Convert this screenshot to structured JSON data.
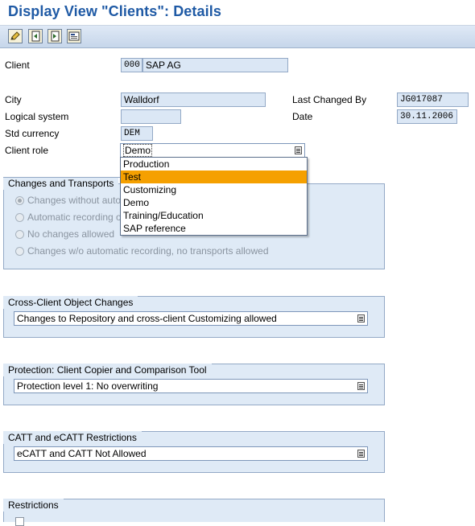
{
  "window": {
    "title": "Display View \"Clients\": Details"
  },
  "toolbar": {
    "buttons": [
      "edit-icon",
      "previous-entry-icon",
      "next-entry-icon",
      "transport-icon"
    ]
  },
  "form": {
    "client_label": "Client",
    "client_number": "000",
    "client_name": "SAP AG",
    "city_label": "City",
    "city_value": "Walldorf",
    "logical_system_label": "Logical system",
    "logical_system_value": "",
    "std_currency_label": "Std currency",
    "std_currency_value": "DEM",
    "client_role_label": "Client role",
    "client_role_value": "Demo",
    "last_changed_by_label": "Last Changed By",
    "last_changed_by_value": "JG017087",
    "date_label": "Date",
    "date_value": "30.11.2006"
  },
  "client_role_dropdown": {
    "options": [
      "Production",
      "Test",
      "Customizing",
      "Demo",
      "Training/Education",
      "SAP reference"
    ],
    "highlighted": "Test"
  },
  "changes_transports": {
    "title": "Changes and Transports",
    "options": [
      "Changes without automatic recording",
      "Automatic recording of changes",
      "No changes allowed",
      "Changes w/o automatic recording, no transports allowed"
    ],
    "selected_index": 0
  },
  "cross_client": {
    "title": "Cross-Client Object Changes",
    "value": "Changes to Repository and cross-client Customizing allowed"
  },
  "protection": {
    "title": "Protection: Client Copier and Comparison Tool",
    "value": "Protection level 1: No overwriting"
  },
  "catt": {
    "title": "CATT and eCATT Restrictions",
    "value": "eCATT and CATT Not Allowed"
  },
  "restrictions": {
    "title": "Restrictions"
  },
  "colors": {
    "title_blue": "#1f5aa5",
    "field_bg": "#dbe7f5",
    "group_bg": "#dfeaf6",
    "highlight": "#f5a000"
  }
}
